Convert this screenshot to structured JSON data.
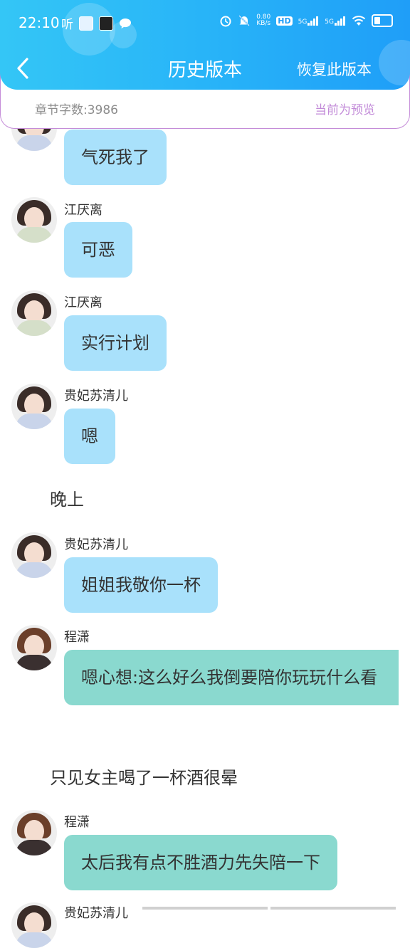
{
  "status_bar": {
    "time": "22:10",
    "listen_label": "听",
    "net_speed_value": "0.80",
    "net_speed_unit": "KB/s",
    "hd_label": "HD",
    "sim1_label": "5G",
    "sim2_label": "5G",
    "icons": [
      "alarm-icon",
      "mute-icon",
      "signal-icon",
      "wifi-icon",
      "battery-icon"
    ]
  },
  "header": {
    "title": "历史版本",
    "restore_label": "恢复此版本",
    "back_icon": "chevron-left-icon"
  },
  "info_bar": {
    "word_count": "章节字数:3986",
    "preview_status": "当前为预览"
  },
  "messages": [
    {
      "type": "chat",
      "name": "",
      "text": "气死我了",
      "color": "blue"
    },
    {
      "type": "chat",
      "name": "江厌离",
      "text": "可恶",
      "color": "blue"
    },
    {
      "type": "chat",
      "name": "江厌离",
      "text": "实行计划",
      "color": "blue"
    },
    {
      "type": "chat",
      "name": "贵妃苏清儿",
      "text": "嗯",
      "color": "blue"
    },
    {
      "type": "narration",
      "text": "晚上"
    },
    {
      "type": "chat",
      "name": "贵妃苏清儿",
      "text": "姐姐我敬你一杯",
      "color": "blue"
    },
    {
      "type": "chat",
      "name": "程潇",
      "text": "嗯心想:这么好么我倒要陪你玩玩什么看",
      "color": "teal"
    },
    {
      "type": "narration",
      "text": "只见女主喝了一杯酒很晕"
    },
    {
      "type": "chat",
      "name": "程潇",
      "text": "太后我有点不胜酒力先失陪一下",
      "color": "teal"
    },
    {
      "type": "chat",
      "name": "贵妃苏清儿",
      "text": "",
      "color": "blue"
    }
  ],
  "colors": {
    "header_start": "#34c6f6",
    "header_end": "#1f9ef8",
    "bubble_blue": "#a9e1fb",
    "bubble_teal": "#8ad9cf",
    "preview_purple": "#c28ad8"
  }
}
